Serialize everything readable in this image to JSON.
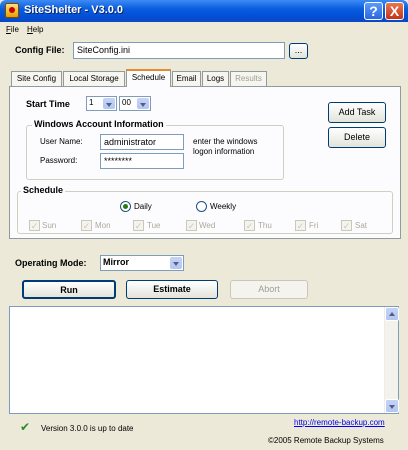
{
  "window": {
    "title": "SiteShelter - V3.0.0",
    "help_button": "?",
    "close_button": "X"
  },
  "menu": [
    {
      "label": "File",
      "accel": "F",
      "rest": "ile"
    },
    {
      "label": "Help",
      "accel": "H",
      "rest": "elp"
    }
  ],
  "config": {
    "label": "Config File:",
    "value": "SiteConfig.ini",
    "browse_label": "..."
  },
  "tabs": [
    {
      "label": "Site Config",
      "active": false,
      "enabled": true
    },
    {
      "label": "Local Storage",
      "active": false,
      "enabled": true
    },
    {
      "label": "Schedule",
      "active": true,
      "enabled": true
    },
    {
      "label": "Email",
      "active": false,
      "enabled": true
    },
    {
      "label": "Logs",
      "active": false,
      "enabled": true
    },
    {
      "label": "Results",
      "active": false,
      "enabled": false
    }
  ],
  "schedule_tab": {
    "start_time": {
      "label": "Start Time",
      "hour": "1",
      "minute": "00"
    },
    "buttons": {
      "add_task": "Add Task",
      "delete": "Delete"
    },
    "account": {
      "legend": "Windows Account Information",
      "username_label": "User Name:",
      "username_value": "administrator",
      "password_label": "Password:",
      "password_value": "********",
      "hint_line1": "enter the windows",
      "hint_line2": "logon information"
    },
    "schedule": {
      "legend": "Schedule",
      "daily_label": "Daily",
      "weekly_label": "Weekly",
      "selected": "Daily",
      "days": [
        "Sun",
        "Mon",
        "Tue",
        "Wed",
        "Thu",
        "Fri",
        "Sat"
      ],
      "days_checked": [
        true,
        true,
        true,
        true,
        true,
        true,
        true
      ],
      "days_enabled": false
    }
  },
  "operating_mode": {
    "label": "Operating Mode:",
    "value": "Mirror"
  },
  "actions": {
    "run": "Run",
    "estimate": "Estimate",
    "abort": "Abort"
  },
  "status": {
    "version_text": "Version 3.0.0 is up to date",
    "link_text": "http://remote-backup.com",
    "copyright": "©2005 Remote Backup Systems"
  },
  "colors": {
    "titlebar": "#0a5ede",
    "active_tab_accent": "#e68b2c",
    "dialog_bg": "#ece9d8",
    "link": "#0000ee"
  }
}
